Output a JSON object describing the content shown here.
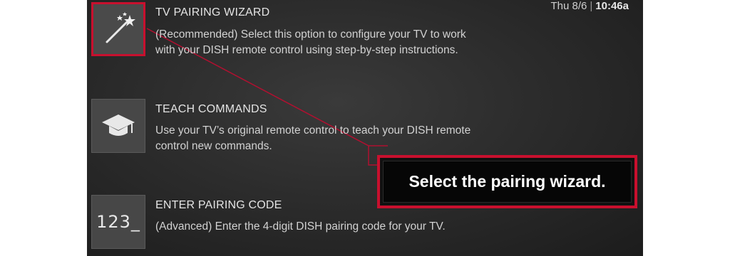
{
  "header": {
    "date": "Thu 8/6",
    "separator": "|",
    "time": "10:46a"
  },
  "options": [
    {
      "title": "TV PAIRING WIZARD",
      "description": "(Recommended) Select this option to configure your TV to work with your DISH remote control using step-by-step instructions.",
      "icon": "magic-wand-icon",
      "selected": true
    },
    {
      "title": "TEACH COMMANDS",
      "description": "Use your TV’s original remote control to teach your DISH remote control new commands.",
      "icon": "graduation-cap-icon",
      "selected": false
    },
    {
      "title": "ENTER PAIRING CODE",
      "description": "(Advanced) Enter the 4-digit DISH pairing code for your TV.",
      "icon": "numeric-code-icon",
      "icon_text": "123_",
      "selected": false
    }
  ],
  "callout": {
    "text": "Select the pairing wizard."
  },
  "colors": {
    "accent": "#c8102e",
    "background": "#2c2c2c",
    "tile": "#474747",
    "text": "#e4e4e4"
  }
}
